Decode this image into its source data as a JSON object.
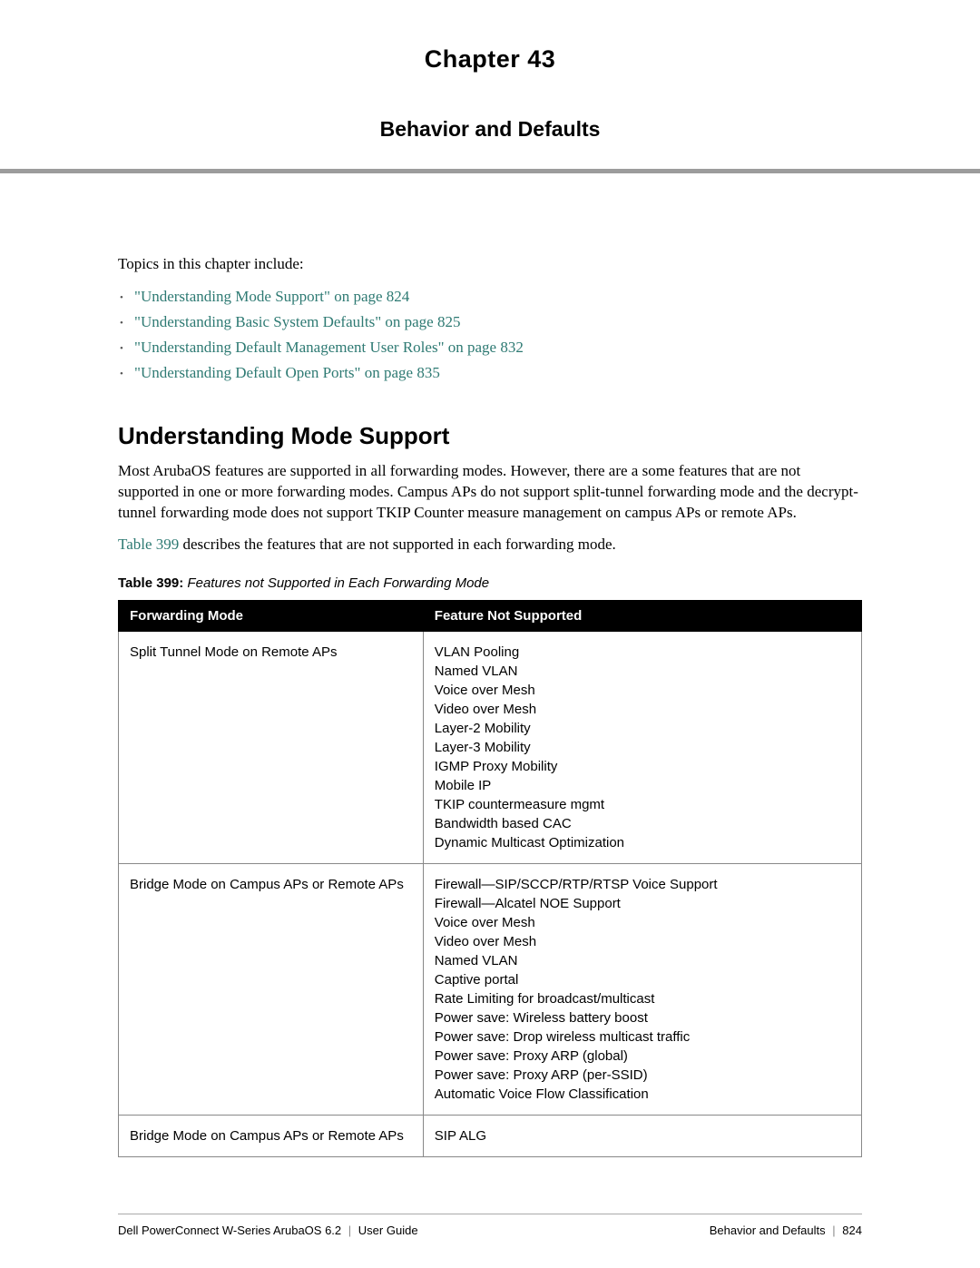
{
  "header": {
    "chapter": "Chapter 43",
    "subtitle": "Behavior and Defaults"
  },
  "intro": "Topics in this chapter include:",
  "toc": [
    "\"Understanding Mode Support\" on page 824",
    "\"Understanding Basic System Defaults\" on page 825",
    "\"Understanding Default Management User Roles\" on page 832",
    "\"Understanding Default Open Ports\" on page 835"
  ],
  "section": {
    "title": "Understanding Mode Support",
    "para1": "Most ArubaOS features are supported in all forwarding modes. However, there are a some features that are not supported in one or more forwarding modes. Campus APs do not support split-tunnel forwarding mode and the decrypt-tunnel forwarding mode does not support TKIP Counter measure management on campus APs or remote APs.",
    "para2_pre": "Table 399",
    "para2_post": " describes the features that are not supported in each forwarding mode."
  },
  "table": {
    "caption_label": "Table 399:",
    "caption_title": " Features not Supported in Each Forwarding Mode",
    "headers": [
      "Forwarding Mode",
      "Feature Not Supported"
    ],
    "rows": [
      {
        "mode": "Split Tunnel Mode on Remote APs",
        "features": [
          "VLAN Pooling",
          "Named VLAN",
          "Voice over Mesh",
          "Video over Mesh",
          "Layer-2 Mobility",
          "Layer-3 Mobility",
          "IGMP Proxy Mobility",
          "Mobile IP",
          "TKIP countermeasure mgmt",
          "Bandwidth based CAC",
          "Dynamic Multicast Optimization"
        ]
      },
      {
        "mode": "Bridge Mode on Campus APs or Remote APs",
        "features": [
          "Firewall—SIP/SCCP/RTP/RTSP Voice Support",
          "Firewall—Alcatel NOE Support",
          "Voice over Mesh",
          "Video over Mesh",
          "Named VLAN",
          "Captive portal",
          "Rate Limiting for broadcast/multicast",
          "Power save: Wireless battery boost",
          "Power save: Drop wireless multicast traffic",
          "Power save: Proxy ARP (global)",
          "Power save: Proxy ARP (per-SSID)",
          "Automatic Voice Flow Classification"
        ]
      },
      {
        "mode": "Bridge Mode on Campus APs or Remote APs",
        "features": [
          "SIP ALG"
        ]
      }
    ]
  },
  "footer": {
    "left1": "Dell PowerConnect W-Series ArubaOS 6.2",
    "left2": "User Guide",
    "right1": "Behavior and Defaults",
    "right2": "824"
  }
}
